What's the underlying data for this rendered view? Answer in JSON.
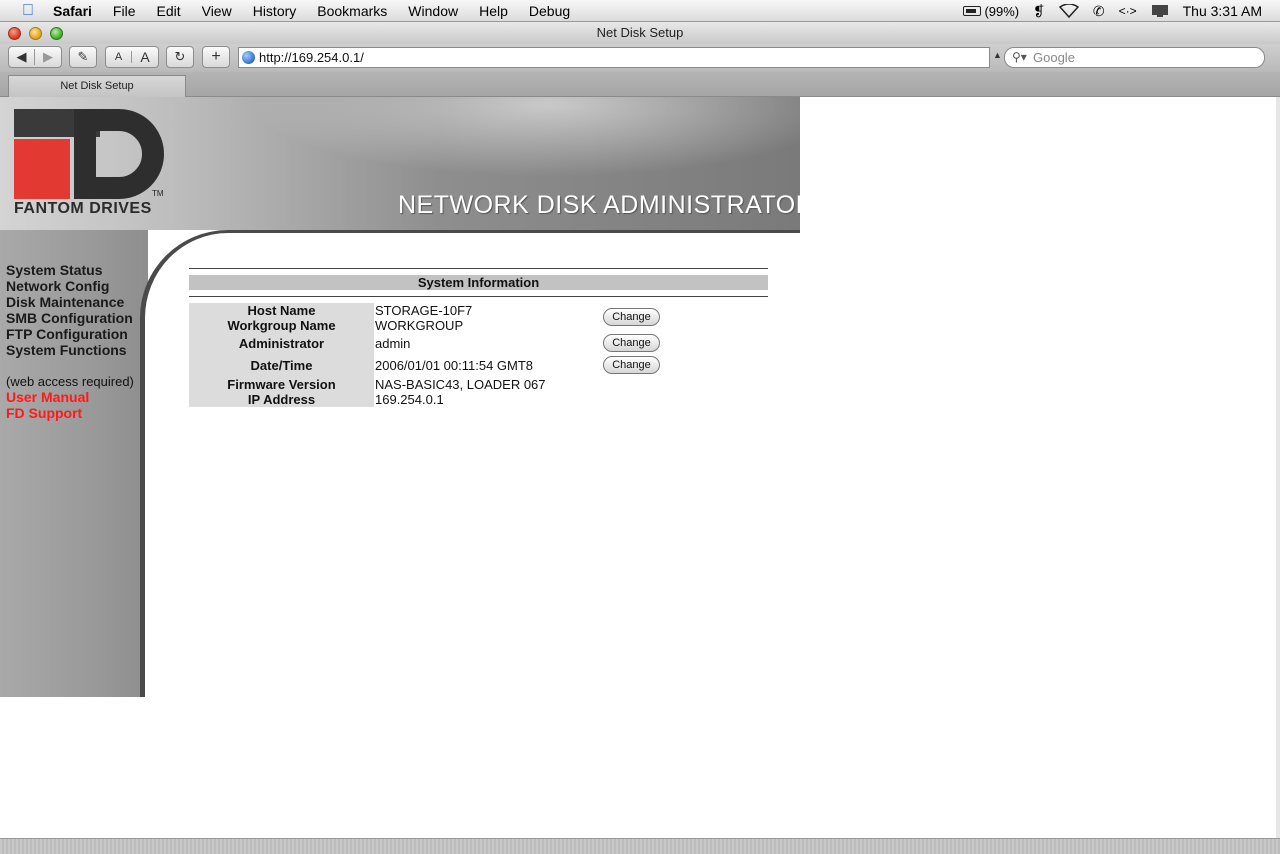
{
  "menubar": {
    "app": "Safari",
    "items": [
      "File",
      "Edit",
      "View",
      "History",
      "Bookmarks",
      "Window",
      "Help",
      "Debug"
    ],
    "battery": "(99%)",
    "clock": "Thu 3:31 AM"
  },
  "window": {
    "title": "Net Disk Setup",
    "url": "http://169.254.0.1/",
    "search_placeholder": "Google",
    "tab_title": "Net Disk Setup",
    "text_smaller": "A",
    "text_bigger": "A",
    "add_bookmark": "+"
  },
  "page": {
    "brand": "FANTOM DRIVES",
    "brand_logo": "FD",
    "trademark": "TM",
    "header_title": "NETWORK DISK ADMINISTRATOR",
    "nav": [
      "System Status",
      "Network Config",
      "Disk Maintenance",
      "SMB Configuration",
      "FTP Configuration",
      "System Functions"
    ],
    "nav_note": "(web access required)",
    "external_links": [
      "User Manual",
      "FD Support"
    ],
    "section_title": "System Information",
    "rows": [
      {
        "label": "Host Name",
        "value": "STORAGE-10F7"
      },
      {
        "label": "Workgroup Name",
        "value": "WORKGROUP"
      },
      {
        "label": "Administrator",
        "value": "admin"
      },
      {
        "label": "Date/Time",
        "value": "2006/01/01 00:11:54 GMT8"
      },
      {
        "label": "Firmware Version",
        "value": "NAS-BASIC43, LOADER 067"
      },
      {
        "label": "IP Address",
        "value": "169.254.0.1"
      }
    ],
    "change_label": "Change"
  },
  "colors": {
    "link_red": "#ff1a1a",
    "logo_red": "#e23a33",
    "header_gray": "#8e8e8e"
  }
}
